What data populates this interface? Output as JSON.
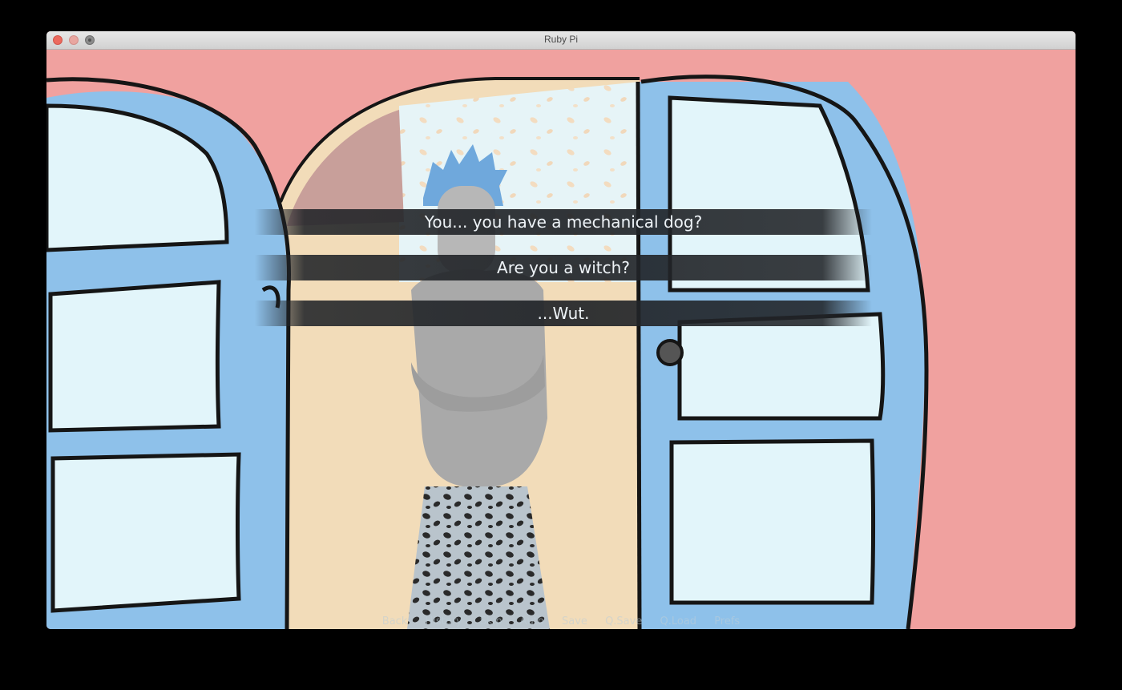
{
  "window": {
    "title": "Ruby Pi"
  },
  "choices": [
    {
      "label": "You... you have a mechanical dog?"
    },
    {
      "label": "Are you a witch?"
    },
    {
      "label": "...Wut."
    }
  ],
  "quick_menu": [
    "Back",
    "History",
    "Skip",
    "Auto",
    "Save",
    "Q.Save",
    "Q.Load",
    "Prefs"
  ],
  "colors": {
    "wall": "#f0a19f",
    "door_frame": "#8ec1ea",
    "window_pane": "#e2f5fa",
    "floor": "#f2dcb9",
    "outline": "#151515",
    "character_hair": "#6fa8dc",
    "character_sweater": "#a9a9a9"
  },
  "icons": [
    "close-traffic-light",
    "minimize-traffic-light",
    "zoom-traffic-light"
  ]
}
